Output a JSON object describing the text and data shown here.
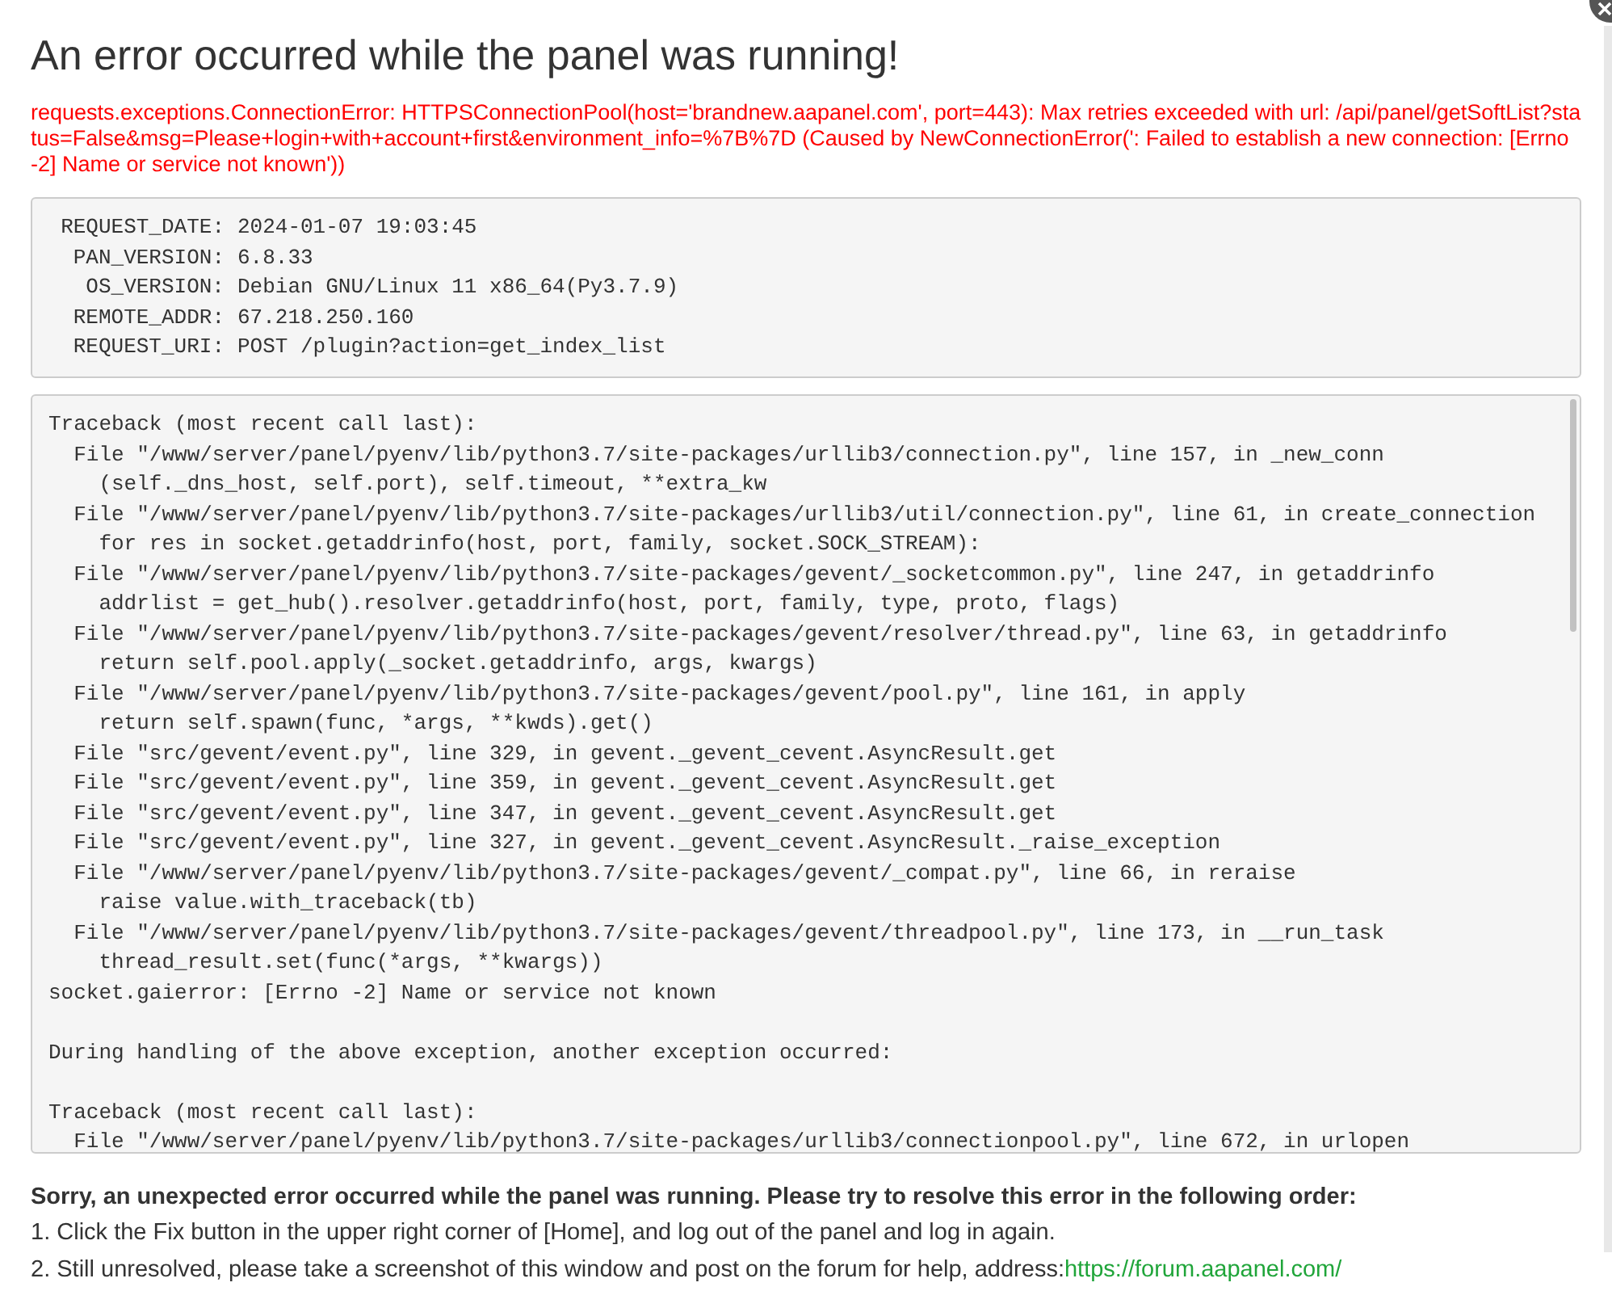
{
  "title": "An error occurred while the panel was running!",
  "error_message": "requests.exceptions.ConnectionError: HTTPSConnectionPool(host='brandnew.aapanel.com', port=443): Max retries exceeded with url: /api/panel/getSoftList?status=False&msg=Please+login+with+account+first&environment_info=%7B%7D (Caused by NewConnectionError(': Failed to establish a new connection: [Errno -2] Name or service not known'))",
  "request_info": [
    {
      "key": "REQUEST_DATE:",
      "value": "2024-01-07 19:03:45"
    },
    {
      "key": "PAN_VERSION:",
      "value": "6.8.33"
    },
    {
      "key": "OS_VERSION:",
      "value": "Debian GNU/Linux 11 x86_64(Py3.7.9)"
    },
    {
      "key": "REMOTE_ADDR:",
      "value": "67.218.250.160"
    },
    {
      "key": "REQUEST_URI:",
      "value": "POST /plugin?action=get_index_list"
    }
  ],
  "traceback": [
    "Traceback (most recent call last):",
    "  File \"/www/server/panel/pyenv/lib/python3.7/site-packages/urllib3/connection.py\", line 157, in _new_conn",
    "    (self._dns_host, self.port), self.timeout, **extra_kw",
    "  File \"/www/server/panel/pyenv/lib/python3.7/site-packages/urllib3/util/connection.py\", line 61, in create_connection",
    "    for res in socket.getaddrinfo(host, port, family, socket.SOCK_STREAM):",
    "  File \"/www/server/panel/pyenv/lib/python3.7/site-packages/gevent/_socketcommon.py\", line 247, in getaddrinfo",
    "    addrlist = get_hub().resolver.getaddrinfo(host, port, family, type, proto, flags)",
    "  File \"/www/server/panel/pyenv/lib/python3.7/site-packages/gevent/resolver/thread.py\", line 63, in getaddrinfo",
    "    return self.pool.apply(_socket.getaddrinfo, args, kwargs)",
    "  File \"/www/server/panel/pyenv/lib/python3.7/site-packages/gevent/pool.py\", line 161, in apply",
    "    return self.spawn(func, *args, **kwds).get()",
    "  File \"src/gevent/event.py\", line 329, in gevent._gevent_cevent.AsyncResult.get",
    "  File \"src/gevent/event.py\", line 359, in gevent._gevent_cevent.AsyncResult.get",
    "  File \"src/gevent/event.py\", line 347, in gevent._gevent_cevent.AsyncResult.get",
    "  File \"src/gevent/event.py\", line 327, in gevent._gevent_cevent.AsyncResult._raise_exception",
    "  File \"/www/server/panel/pyenv/lib/python3.7/site-packages/gevent/_compat.py\", line 66, in reraise",
    "    raise value.with_traceback(tb)",
    "  File \"/www/server/panel/pyenv/lib/python3.7/site-packages/gevent/threadpool.py\", line 173, in __run_task",
    "    thread_result.set(func(*args, **kwargs))",
    "socket.gaierror: [Errno -2] Name or service not known",
    {
      "kind": "blank"
    },
    "During handling of the above exception, another exception occurred:",
    {
      "kind": "blank"
    },
    "Traceback (most recent call last):",
    "  File \"/www/server/panel/pyenv/lib/python3.7/site-packages/urllib3/connectionpool.py\", line 672, in urlopen"
  ],
  "help": {
    "heading": "Sorry, an unexpected error occurred while the panel was running. Please try to resolve this error in the following order:",
    "steps": [
      {
        "text": "1. Click the Fix button in the upper right corner of [Home], and log out of the panel and log in again."
      },
      {
        "text": "2. Still unresolved, please take a screenshot of this window and post on the forum for help, address:",
        "link": "https://forum.aapanel.com/"
      }
    ]
  }
}
